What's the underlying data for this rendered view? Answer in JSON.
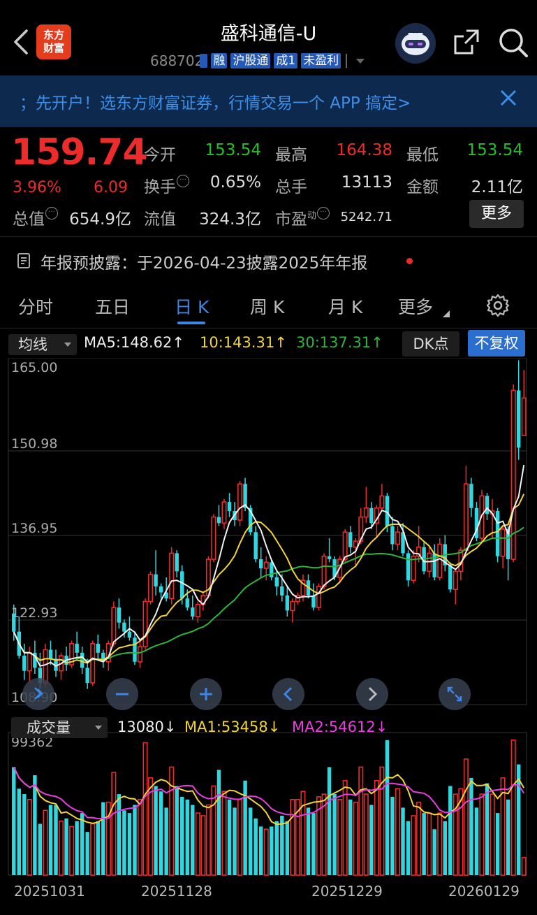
{
  "header": {
    "title": "盛科通信-U",
    "code": "688702",
    "tags": [
      "",
      "融",
      "沪股通",
      "成1",
      "未盈利"
    ],
    "logo_line1": "东方",
    "logo_line2": "财富"
  },
  "banner": {
    "text": "；先开户！选东方财富证券，行情交易一个 APP 搞定>"
  },
  "quote": {
    "price": "159.74",
    "change_pct": "3.96%",
    "change": "6.09",
    "open_label": "今开",
    "open": "153.54",
    "high_label": "最高",
    "high": "164.38",
    "low_label": "最低",
    "low": "153.54",
    "turnover_label": "换手",
    "turnover": "0.65%",
    "volume_label": "总手",
    "volume": "13113",
    "amount_label": "金额",
    "amount": "2.11亿",
    "mktcap_label": "总值",
    "mktcap": "654.9亿",
    "float_label": "流值",
    "float_cap": "324.3亿",
    "pe_label": "市盈",
    "pe_sup": "动",
    "pe": "5242.71",
    "more_label": "更多",
    "colors": {
      "up": "#ee2b2b",
      "down": "#24c02a"
    }
  },
  "notice": {
    "text": "年报预披露：于2026-04-23披露2025年年报"
  },
  "tabs": [
    {
      "label": "分时"
    },
    {
      "label": "五日"
    },
    {
      "label": "日 K"
    },
    {
      "label": "周 K"
    },
    {
      "label": "月 K"
    },
    {
      "label": "更多"
    }
  ],
  "indicators": {
    "ma_select": "均线",
    "ma5": "MA5:148.62",
    "ma10": "10:143.31",
    "ma30": "30:137.31",
    "dk": "DK点",
    "fq": "不复权",
    "vol_select": "成交量",
    "vol": "13080",
    "vol_ma1": "MA1:53458",
    "vol_ma2": "MA2:54612"
  },
  "chart_data": {
    "type": "candlestick",
    "price_axis": {
      "ticks": [
        "165.00",
        "150.98",
        "136.95",
        "122.93",
        "108.90"
      ],
      "ylim": [
        108.9,
        165.0
      ]
    },
    "volume_axis": {
      "max_label": "99362",
      "ylim": [
        0,
        99362
      ]
    },
    "x_ticks": [
      "20251031",
      "20251128",
      "20251229",
      "20260129"
    ],
    "ohlc": [
      [
        124.0,
        125.5,
        119.5,
        121.0
      ],
      [
        121.0,
        123.5,
        116.5,
        117.0
      ],
      [
        117.0,
        119.0,
        113.0,
        114.5
      ],
      [
        114.5,
        118.5,
        112.5,
        117.5
      ],
      [
        117.5,
        119.5,
        114.0,
        115.0
      ],
      [
        115.0,
        117.5,
        111.5,
        112.5
      ],
      [
        112.5,
        119.0,
        112.0,
        118.0
      ],
      [
        118.0,
        119.5,
        115.5,
        116.5
      ],
      [
        116.5,
        118.0,
        113.5,
        114.5
      ],
      [
        114.5,
        117.5,
        113.0,
        117.0
      ],
      [
        117.0,
        118.5,
        114.5,
        115.5
      ],
      [
        115.5,
        119.5,
        115.0,
        119.0
      ],
      [
        119.0,
        121.0,
        116.5,
        117.5
      ],
      [
        117.5,
        118.5,
        114.0,
        115.0
      ],
      [
        115.0,
        116.5,
        111.5,
        112.5
      ],
      [
        112.5,
        119.5,
        112.0,
        119.0
      ],
      [
        119.0,
        120.5,
        116.5,
        117.5
      ],
      [
        117.5,
        118.0,
        115.0,
        116.0
      ],
      [
        116.0,
        119.5,
        114.5,
        119.0
      ],
      [
        119.0,
        126.0,
        118.5,
        125.0
      ],
      [
        125.0,
        126.5,
        121.5,
        122.5
      ],
      [
        122.5,
        123.0,
        120.0,
        121.0
      ],
      [
        121.0,
        123.5,
        119.5,
        120.0
      ],
      [
        120.0,
        121.0,
        115.5,
        116.0
      ],
      [
        116.0,
        119.5,
        115.0,
        118.5
      ],
      [
        118.5,
        126.5,
        118.0,
        126.0
      ],
      [
        126.0,
        131.0,
        125.5,
        130.5
      ],
      [
        130.5,
        134.5,
        127.0,
        128.5
      ],
      [
        128.5,
        129.0,
        126.5,
        127.5
      ],
      [
        127.5,
        130.0,
        126.0,
        126.5
      ],
      [
        126.5,
        135.0,
        125.5,
        134.0
      ],
      [
        134.0,
        134.5,
        130.0,
        131.0
      ],
      [
        131.0,
        132.0,
        125.5,
        126.5
      ],
      [
        126.5,
        128.0,
        124.5,
        125.0
      ],
      [
        125.0,
        127.0,
        123.0,
        123.5
      ],
      [
        123.5,
        126.0,
        122.5,
        125.5
      ],
      [
        125.5,
        127.5,
        124.5,
        127.0
      ],
      [
        127.0,
        133.5,
        126.5,
        133.0
      ],
      [
        133.0,
        140.5,
        132.5,
        140.0
      ],
      [
        140.0,
        142.0,
        138.5,
        139.0
      ],
      [
        139.0,
        143.0,
        138.0,
        142.5
      ],
      [
        142.5,
        144.0,
        140.0,
        141.0
      ],
      [
        141.0,
        142.5,
        138.5,
        139.5
      ],
      [
        139.5,
        146.0,
        138.5,
        145.5
      ],
      [
        145.5,
        146.5,
        141.0,
        141.5
      ],
      [
        141.5,
        142.0,
        137.0,
        137.5
      ],
      [
        137.5,
        138.5,
        132.5,
        133.0
      ],
      [
        133.0,
        135.0,
        130.0,
        131.5
      ],
      [
        131.5,
        133.5,
        129.5,
        132.5
      ],
      [
        132.5,
        133.0,
        129.5,
        130.0
      ],
      [
        130.0,
        131.0,
        127.0,
        128.5
      ],
      [
        128.5,
        130.5,
        126.0,
        127.0
      ],
      [
        127.0,
        128.5,
        123.5,
        124.5
      ],
      [
        124.5,
        126.5,
        122.5,
        126.0
      ],
      [
        126.0,
        127.5,
        125.5,
        127.0
      ],
      [
        127.0,
        130.5,
        126.0,
        129.5
      ],
      [
        129.5,
        130.5,
        126.5,
        127.0
      ],
      [
        127.0,
        129.0,
        124.5,
        125.0
      ],
      [
        125.0,
        129.0,
        124.5,
        128.5
      ],
      [
        128.5,
        134.0,
        128.0,
        133.5
      ],
      [
        133.5,
        136.5,
        132.5,
        133.0
      ],
      [
        133.0,
        133.5,
        129.5,
        130.0
      ],
      [
        130.0,
        133.5,
        129.0,
        133.0
      ],
      [
        133.0,
        138.0,
        132.5,
        137.5
      ],
      [
        137.5,
        138.5,
        134.0,
        135.0
      ],
      [
        135.0,
        136.5,
        132.0,
        136.0
      ],
      [
        136.0,
        141.5,
        135.5,
        140.0
      ],
      [
        140.0,
        145.0,
        139.0,
        141.5
      ],
      [
        141.5,
        142.5,
        138.0,
        139.0
      ],
      [
        139.0,
        142.0,
        136.5,
        141.5
      ],
      [
        141.5,
        145.5,
        141.0,
        143.5
      ],
      [
        143.5,
        144.0,
        137.5,
        138.5
      ],
      [
        138.5,
        140.0,
        134.5,
        135.5
      ],
      [
        135.5,
        138.5,
        134.5,
        137.5
      ],
      [
        137.5,
        139.0,
        133.5,
        134.0
      ],
      [
        134.0,
        134.5,
        128.5,
        129.5
      ],
      [
        129.5,
        134.5,
        129.0,
        133.5
      ],
      [
        133.5,
        138.5,
        132.5,
        135.0
      ],
      [
        135.0,
        136.0,
        130.5,
        131.0
      ],
      [
        131.0,
        135.0,
        130.0,
        134.0
      ],
      [
        134.0,
        135.5,
        129.5,
        130.0
      ],
      [
        130.0,
        136.5,
        129.5,
        135.5
      ],
      [
        135.5,
        137.0,
        131.0,
        132.0
      ],
      [
        132.0,
        132.5,
        127.5,
        128.0
      ],
      [
        128.0,
        131.5,
        125.5,
        131.0
      ],
      [
        131.0,
        135.0,
        129.5,
        134.5
      ],
      [
        134.5,
        148.5,
        134.0,
        145.5
      ],
      [
        145.5,
        146.5,
        140.0,
        141.5
      ],
      [
        141.5,
        142.5,
        136.0,
        136.5
      ],
      [
        136.5,
        144.5,
        136.0,
        143.5
      ],
      [
        143.5,
        144.0,
        139.5,
        140.5
      ],
      [
        140.5,
        143.0,
        136.5,
        141.0
      ],
      [
        141.0,
        141.5,
        132.5,
        133.5
      ],
      [
        133.5,
        138.5,
        131.5,
        138.0
      ],
      [
        138.0,
        138.5,
        129.5,
        133.0
      ],
      [
        133.0,
        162.0,
        132.5,
        161.0
      ],
      [
        161.0,
        166.0,
        149.5,
        151.5
      ],
      [
        153.5,
        164.38,
        153.54,
        159.74
      ]
    ],
    "volume": [
      80000,
      64000,
      60000,
      56000,
      74000,
      38000,
      48000,
      52000,
      52000,
      40000,
      42000,
      36000,
      40000,
      46000,
      32000,
      38000,
      40000,
      54000,
      54000,
      76000,
      60000,
      48000,
      46000,
      52000,
      56000,
      98000,
      72000,
      66000,
      62000,
      50000,
      80000,
      66000,
      58000,
      56000,
      52000,
      46000,
      44000,
      52000,
      66000,
      78000,
      62000,
      56000,
      50000,
      56000,
      70000,
      50000,
      42000,
      36000,
      34000,
      36000,
      40000,
      44000,
      40000,
      56000,
      56000,
      62000,
      50000,
      46000,
      58000,
      60000,
      80000,
      60000,
      56000,
      70000,
      56000,
      54000,
      80000,
      60000,
      52000,
      70000,
      80000,
      100000,
      58000,
      64000,
      50000,
      40000,
      44000,
      54000,
      46000,
      46000,
      34000,
      46000,
      40000,
      66000,
      60000,
      64000,
      86000,
      72000,
      50000,
      60000,
      68000,
      60000,
      46000,
      72000,
      56000,
      100000,
      82000,
      13080
    ]
  }
}
